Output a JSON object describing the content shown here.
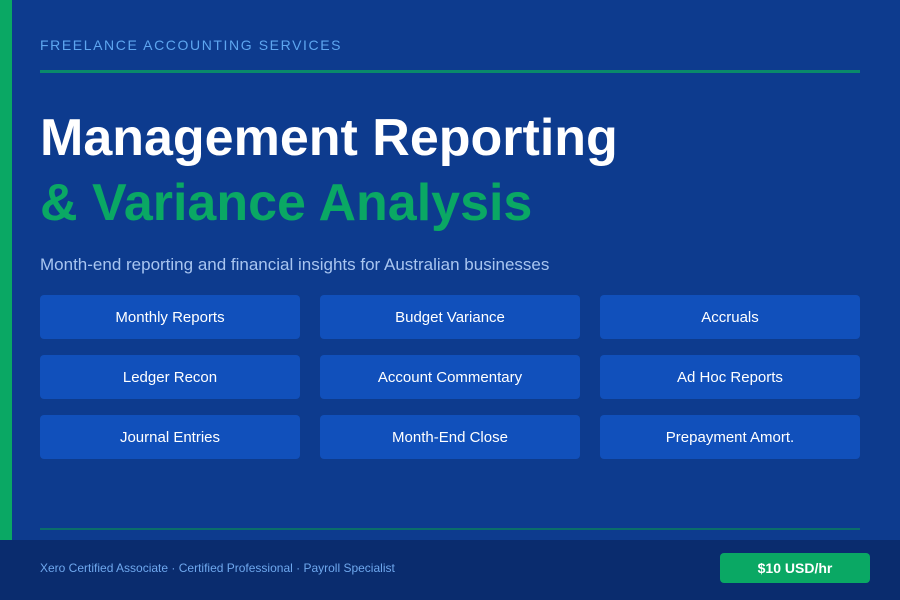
{
  "header": {
    "eyebrow": "FREELANCE ACCOUNTING SERVICES",
    "title_line1": "Management Reporting",
    "title_line2": "& Variance Analysis",
    "subtitle": "Month-end reporting and financial insights for Australian businesses"
  },
  "services": [
    {
      "label": "Monthly Reports"
    },
    {
      "label": "Budget Variance"
    },
    {
      "label": "Accruals"
    },
    {
      "label": "Ledger Recon"
    },
    {
      "label": "Account Commentary"
    },
    {
      "label": "Ad Hoc Reports"
    },
    {
      "label": "Journal Entries"
    },
    {
      "label": "Month-End Close"
    },
    {
      "label": "Prepayment Amort."
    }
  ],
  "footer": {
    "credentials": "Xero Certified Associate · Certified Professional · Payroll Specialist",
    "rate": "$10 USD/hr"
  },
  "colors": {
    "background": "#0d3b8e",
    "accent": "#0aa864",
    "tile": "#1150bb",
    "footer": "#0a2c6e"
  }
}
